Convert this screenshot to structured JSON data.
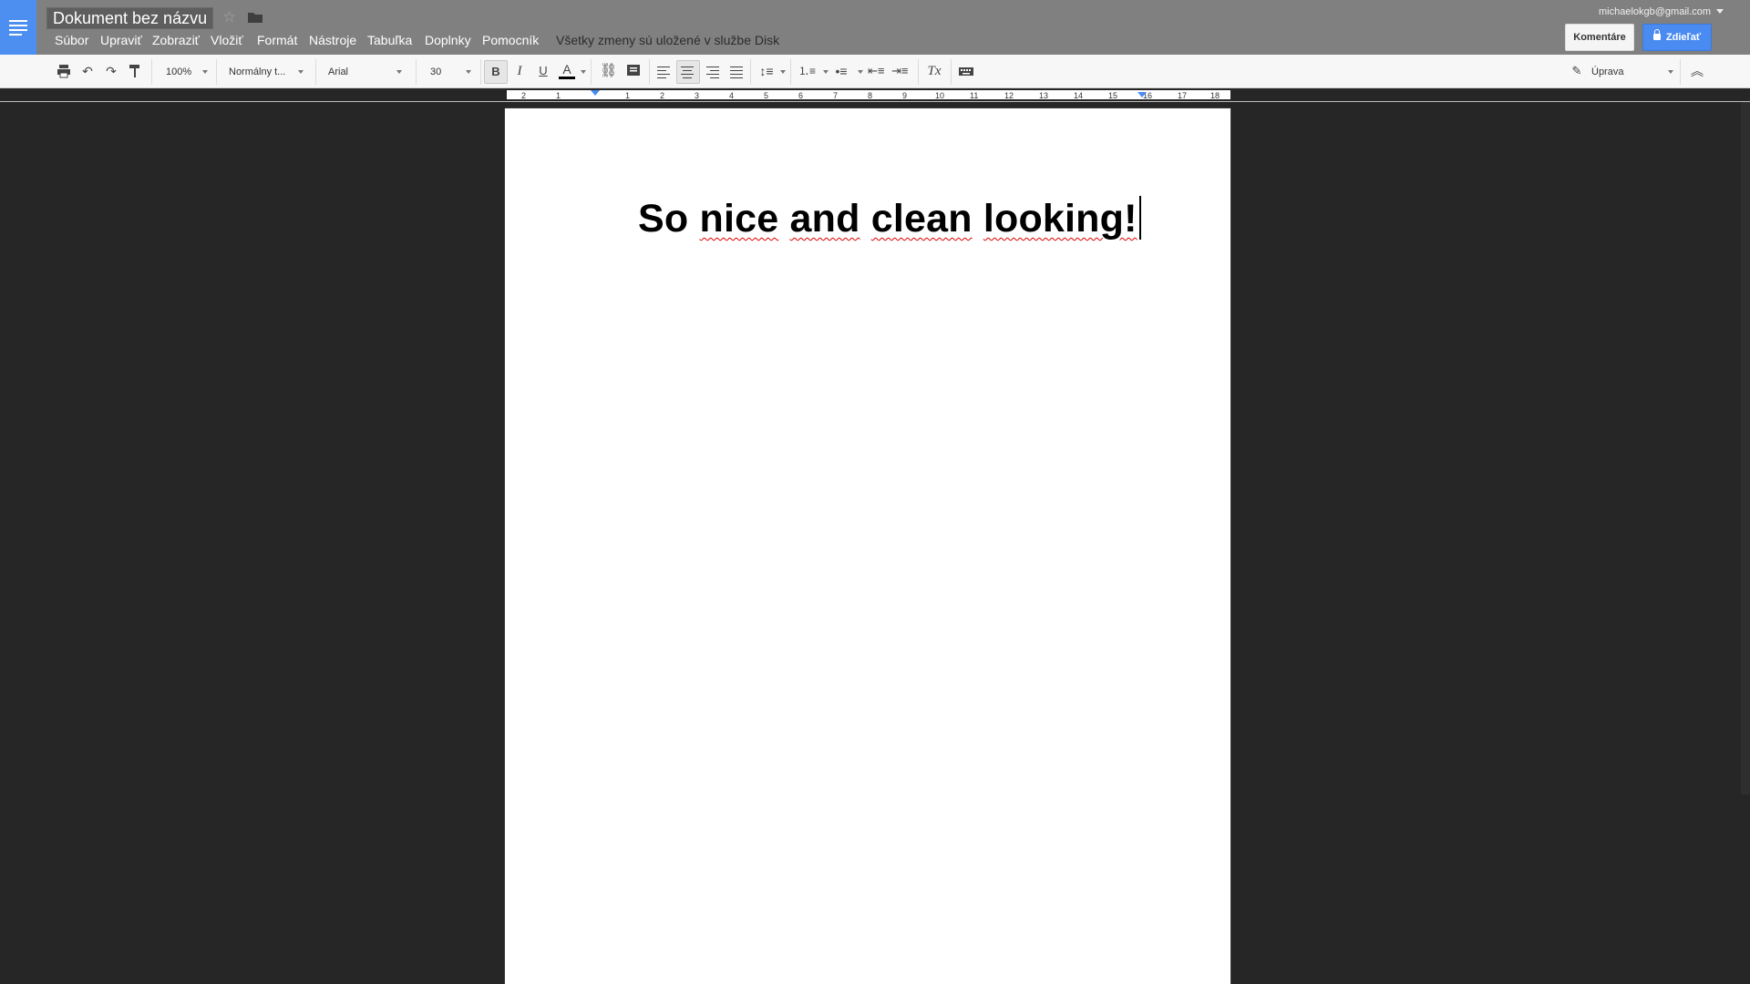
{
  "doc": {
    "title": "Dokument bez názvu",
    "save_status": "Všetky zmeny sú uložené v službe Disk"
  },
  "menu": [
    "Súbor",
    "Upraviť",
    "Zobraziť",
    "Vložiť",
    "Formát",
    "Nástroje",
    "Tabuľka",
    "Doplnky",
    "Pomocník"
  ],
  "account": {
    "email": "michaelokgb@gmail.com"
  },
  "buttons": {
    "comments": "Komentáre",
    "share": "Zdieľať"
  },
  "toolbar": {
    "zoom": "100%",
    "style": "Normálny t...",
    "font": "Arial",
    "size": "30",
    "bold": "B",
    "italic": "I",
    "underline": "U",
    "text_color": "A",
    "mode": "Úprava",
    "clear_format": "Tx"
  },
  "ruler": [
    "2",
    "1",
    "1",
    "2",
    "3",
    "4",
    "5",
    "6",
    "7",
    "8",
    "9",
    "10",
    "11",
    "12",
    "13",
    "14",
    "15",
    "16",
    "17",
    "18"
  ],
  "body": {
    "words": [
      "So",
      "nice",
      "and",
      "clean",
      "looking!"
    ]
  },
  "colors": {
    "accent": "#4a8bf2",
    "titlebar": "#808080",
    "canvas": "#262626"
  }
}
